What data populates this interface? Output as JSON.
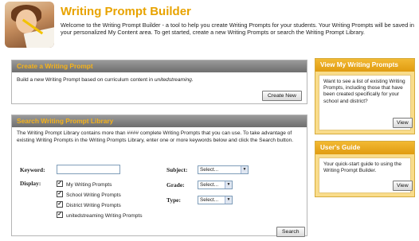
{
  "header": {
    "title": "Writing Prompt Builder",
    "intro": "Welcome to the Writing Prompt Builder - a tool to help you create Writing Prompts for your students. Your Writing Prompts will be saved in your personalized My Content area. To get started, create a new Writing Prompts or search the Writing Prompt Library."
  },
  "create_panel": {
    "title": "Create a Writing Prompt",
    "text_before": "Build a new Writing Prompt based on curriculum content in ",
    "text_em": "unitedstreaming",
    "text_after": ".",
    "button_label": "Create New"
  },
  "search_panel": {
    "title": "Search Writing Prompt Library",
    "description": "The Writing Prompt Library contains more than #### complete Writing Prompts that you can use. To take advantage of existing Writing Prompts in the Writing Prompts Library, enter one or more keywords below and click the Search button.",
    "keyword_label": "Keyword:",
    "keyword_value": "",
    "display_label": "Display:",
    "display_options": [
      {
        "label": "My Writing Prompts",
        "checked": true
      },
      {
        "label": "School Writing Prompts",
        "checked": true
      },
      {
        "label": "District Writing Prompts",
        "checked": true
      },
      {
        "label": "unitedstreaming Writing Prompts",
        "checked": true
      }
    ],
    "subject_label": "Subject:",
    "subject_value": "Select...",
    "grade_label": "Grade:",
    "grade_value": "Select...",
    "type_label": "Type:",
    "type_value": "Select...",
    "search_button": "Search"
  },
  "my_prompts_panel": {
    "title": "View My Writing Prompts",
    "text": "Want to see a list of existing Writing Prompts, including those that have been created specifically for your school and district?",
    "button_label": "View"
  },
  "guide_panel": {
    "title": "User's Guide",
    "text": "Your quick-start guide to using the Writing Prompt Builder.",
    "button_label": "View"
  },
  "colors": {
    "accent": "#e8a300",
    "panel_header": "#7a7a7a",
    "gold": "#f2b933"
  },
  "icons": {
    "hero": "student-writing-photo",
    "dropdown": "chevron-down-icon",
    "checkbox": "checkmark-icon"
  }
}
